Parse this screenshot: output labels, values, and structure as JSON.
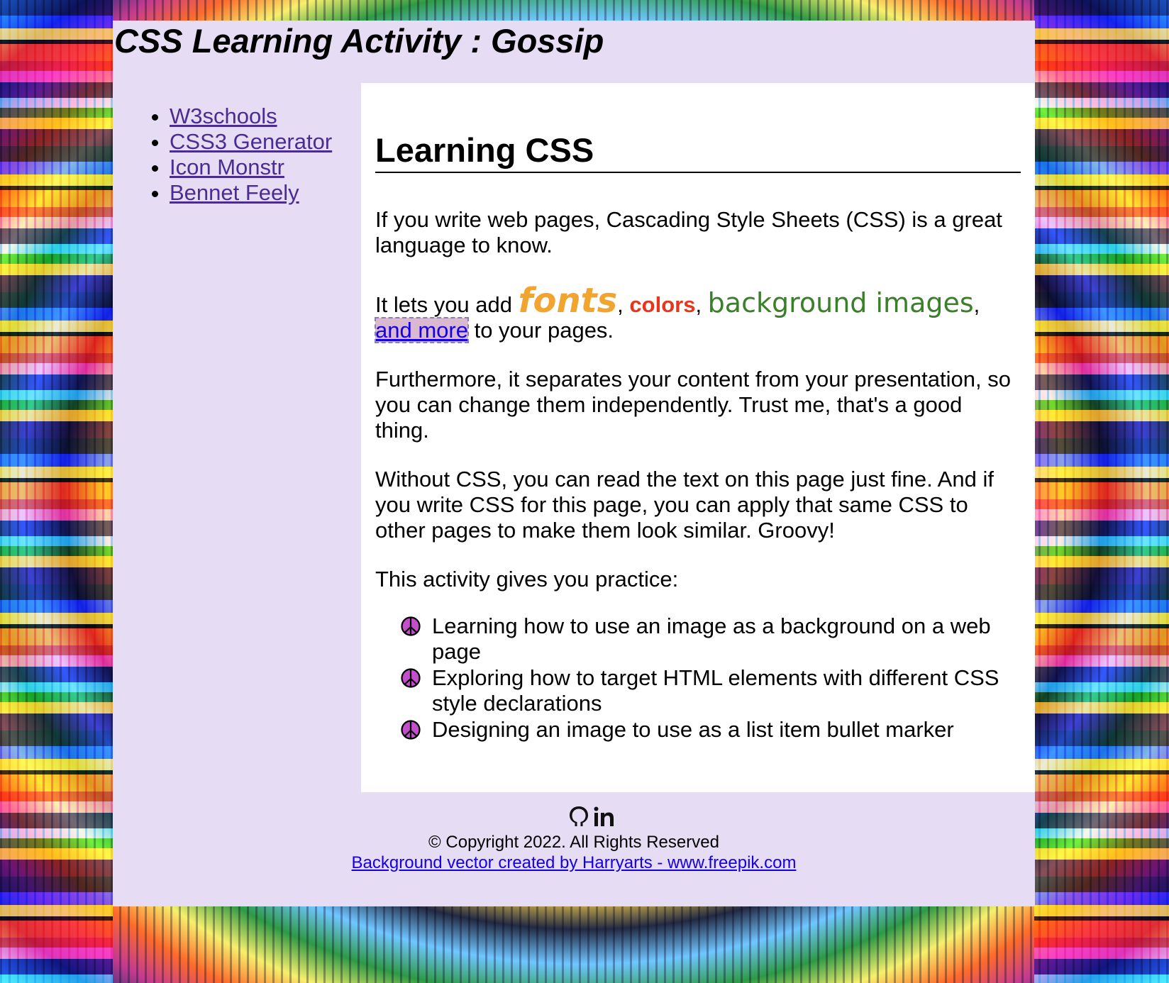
{
  "site": {
    "title": "CSS Learning Activity : Gossip"
  },
  "sidebar": {
    "links": [
      {
        "label": "W3schools"
      },
      {
        "label": "CSS3 Generator"
      },
      {
        "label": "Icon Monstr"
      },
      {
        "label": "Bennet Feely"
      }
    ]
  },
  "main": {
    "heading": "Learning CSS",
    "p1": "If you write web pages, Cascading Style Sheets (CSS) is a great language to know.",
    "p2": {
      "prefix": "It lets you add ",
      "fonts": "fonts",
      "sep1": ", ",
      "colors": "colors",
      "sep2": ", ",
      "background_images": "background images",
      "sep3": ", ",
      "link": "and more",
      "suffix": " to your pages."
    },
    "p3": "Furthermore, it separates your content from your presentation, so you can change them independently. Trust me, that's a good thing.",
    "p4": "Without CSS, you can read the text on this page just fine. And if you write CSS for this page, you can apply that same CSS to other pages to make them look similar. Groovy!",
    "p5": "This activity gives you practice:",
    "practice_items": [
      "Learning how to use an image as a background on a web page",
      "Exploring how to target HTML elements with different CSS style declarations",
      "Designing an image to use as a list item bullet marker"
    ],
    "bullet_icon": "peace-sign-icon"
  },
  "footer": {
    "icons": [
      "github-icon",
      "linkedin-icon"
    ],
    "copyright": "© Copyright 2022. All Rights Reserved",
    "credit": "Background vector created by Harryarts - www.freepik.com"
  },
  "colors": {
    "page_bg": "#e6dcf4",
    "content_bg": "#ffffff",
    "sidebar_link": "#4b2c91",
    "link": "#1400e8",
    "fonts_word": "#f2a430",
    "colors_word": "#e8361c",
    "bg_images_word": "#3a7f2a"
  }
}
